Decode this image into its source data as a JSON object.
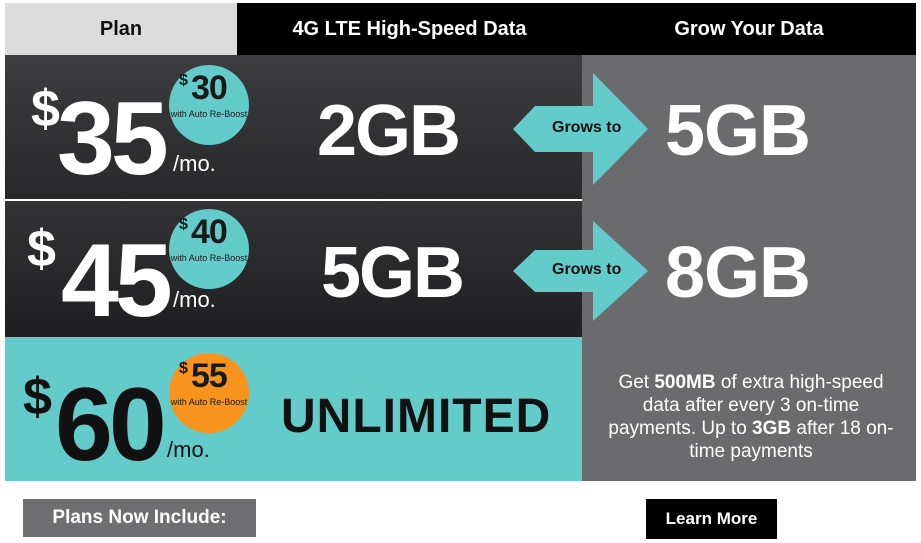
{
  "header": {
    "plan": "Plan",
    "data": "4G LTE High-Speed Data",
    "grow": "Grow Your Data"
  },
  "plans": [
    {
      "currency": "$",
      "price": "35",
      "per": "/mo.",
      "badge_currency": "$",
      "badge_price": "30",
      "badge_note": "with Auto Re-Boost",
      "badge_color": "#63cbc9",
      "data": "2GB",
      "grows_to_label": "Grows to",
      "grows_to": "5GB"
    },
    {
      "currency": "$",
      "price": "45",
      "per": "/mo.",
      "badge_currency": "$",
      "badge_price": "40",
      "badge_note": "with Auto Re-Boost",
      "badge_color": "#63cbc9",
      "data": "5GB",
      "grows_to_label": "Grows to",
      "grows_to": "8GB"
    },
    {
      "currency": "$",
      "price": "60",
      "per": "/mo.",
      "badge_currency": "$",
      "badge_price": "55",
      "badge_note": "with Auto Re-Boost",
      "badge_color": "#f7941d",
      "data": "UNLIMITED"
    }
  ],
  "promo": {
    "part1": "Get ",
    "bold1": "500MB",
    "part2": " of extra high-speed data after every 3 on-time payments. Up to ",
    "bold2": "3GB",
    "part3": " after 18 on-time payments"
  },
  "footer": {
    "plans_include": "Plans Now Include:",
    "learn_more": "Learn More"
  },
  "colors": {
    "teal": "#63cbc9",
    "orange": "#f7941d",
    "grey": "#6b6b6d"
  }
}
